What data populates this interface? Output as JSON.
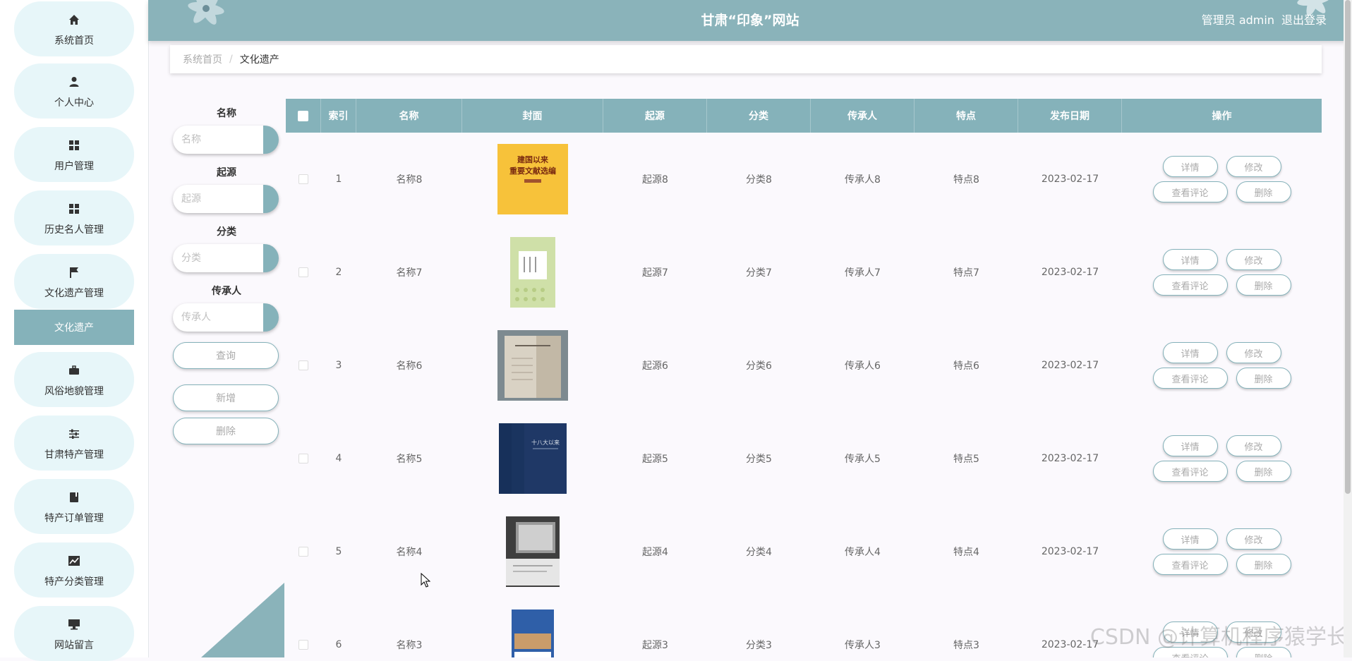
{
  "header": {
    "title": "甘肃“印象”网站",
    "user_label": "管理员 admin",
    "logout": "退出登录"
  },
  "sidebar": {
    "items": [
      {
        "label": "系统首页",
        "icon": "home-icon"
      },
      {
        "label": "个人中心",
        "icon": "person-icon"
      },
      {
        "label": "用户管理",
        "icon": "grid-icon"
      },
      {
        "label": "历史名人管理",
        "icon": "grid-icon"
      },
      {
        "label": "文化遗产管理",
        "icon": "flag-icon"
      },
      {
        "label": "风俗地貌管理",
        "icon": "briefcase-icon"
      },
      {
        "label": "甘肃特产管理",
        "icon": "sliders-icon"
      },
      {
        "label": "特产订单管理",
        "icon": "book-icon"
      },
      {
        "label": "特产分类管理",
        "icon": "chart-icon"
      },
      {
        "label": "网站留言",
        "icon": "monitor-icon"
      }
    ],
    "active_sub": "文化遗产"
  },
  "breadcrumb": {
    "home": "系统首页",
    "separator": "/",
    "current": "文化遗产"
  },
  "search": {
    "name_label": "名称",
    "name_placeholder": "名称",
    "origin_label": "起源",
    "origin_placeholder": "起源",
    "category_label": "分类",
    "category_placeholder": "分类",
    "heir_label": "传承人",
    "heir_placeholder": "传承人",
    "query_btn": "查询",
    "add_btn": "新增",
    "delete_btn": "删除"
  },
  "table": {
    "headers": [
      "索引",
      "名称",
      "封面",
      "起源",
      "分类",
      "传承人",
      "特点",
      "发布日期",
      "操作"
    ],
    "actions": {
      "detail": "详情",
      "edit": "修改",
      "comments": "查看评论",
      "delete": "删除"
    },
    "rows": [
      {
        "index": "1",
        "name": "名称8",
        "cover": "cover-yellow",
        "origin": "起源8",
        "category": "分类8",
        "heir": "传承人8",
        "feature": "特点8",
        "date": "2023-02-17",
        "cover_text": "建国以来 重要文献选编"
      },
      {
        "index": "2",
        "name": "名称7",
        "cover": "cover-green",
        "origin": "起源7",
        "category": "分类7",
        "heir": "传承人7",
        "feature": "特点7",
        "date": "2023-02-17",
        "cover_text": ""
      },
      {
        "index": "3",
        "name": "名称6",
        "cover": "cover-photo",
        "origin": "起源6",
        "category": "分类6",
        "heir": "传承人6",
        "feature": "特点6",
        "date": "2023-02-17",
        "cover_text": ""
      },
      {
        "index": "4",
        "name": "名称5",
        "cover": "cover-navy",
        "origin": "起源5",
        "category": "分类5",
        "heir": "传承人5",
        "feature": "特点5",
        "date": "2023-02-17",
        "cover_text": ""
      },
      {
        "index": "5",
        "name": "名称4",
        "cover": "cover-grey",
        "origin": "起源4",
        "category": "分类4",
        "heir": "传承人4",
        "feature": "特点4",
        "date": "2023-02-17",
        "cover_text": ""
      },
      {
        "index": "6",
        "name": "名称3",
        "cover": "cover-blue",
        "origin": "起源3",
        "category": "分类3",
        "heir": "传承人3",
        "feature": "特点3",
        "date": "2023-02-17",
        "cover_text": ""
      }
    ]
  },
  "watermark": "CSDN @计算机程序猿学长",
  "colors": {
    "accent": "#85b2ba",
    "header": "#8ab3ba",
    "menu_bg": "#e7f6f9"
  }
}
